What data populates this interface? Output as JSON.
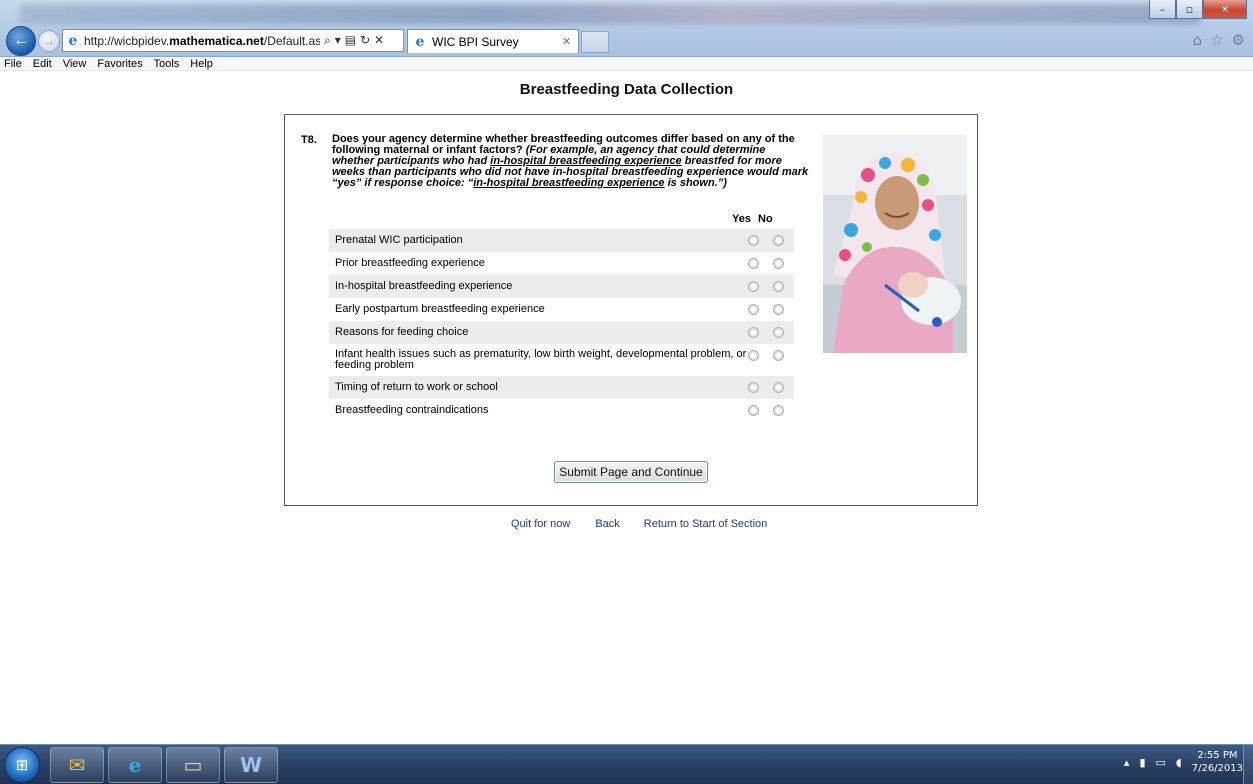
{
  "browser": {
    "url_prefix": "http://wicbpidev.",
    "url_domain": "mathematica.net",
    "url_suffix": "/Default.aspx?Pag",
    "tab_title": "WIC BPI Survey",
    "menu": [
      "File",
      "Edit",
      "View",
      "Favorites",
      "Tools",
      "Help"
    ]
  },
  "page": {
    "title": "Breastfeeding Data Collection"
  },
  "question": {
    "number": "T8.",
    "text_plain": "Does your agency determine whether breastfeeding outcomes differ based on any of the following maternal or infant factors? ",
    "example_1": "(For example, an agency that could determine whether participants who had ",
    "example_link_1": "in-hospital breastfeeding experience",
    "example_2": " breastfed for more weeks than participants who did not have in-hospital breastfeeding experience would mark “yes” if response choice: “",
    "example_link_2": "in-hospital breastfeeding experience",
    "example_3": " is shown.”)",
    "col_yes": "Yes",
    "col_no": "No",
    "items": [
      "Prenatal WIC participation",
      "Prior breastfeeding experience",
      "In-hospital breastfeeding experience",
      "Early postpartum breastfeeding experience",
      "Reasons for feeding choice",
      "Infant health issues such as prematurity, low birth weight, developmental problem, or feeding problem",
      "Timing of return to work or school",
      "Breastfeeding contraindications"
    ]
  },
  "actions": {
    "submit": "Submit Page and Continue",
    "quit": "Quit for now",
    "back": "Back",
    "return": "Return to Start of Section"
  },
  "taskbar": {
    "time": "2:55 PM",
    "date": "7/26/2013"
  },
  "colors": {
    "link": "#1a3a9a",
    "row_shade": "#ececec",
    "chrome": "#b5cbe6"
  }
}
